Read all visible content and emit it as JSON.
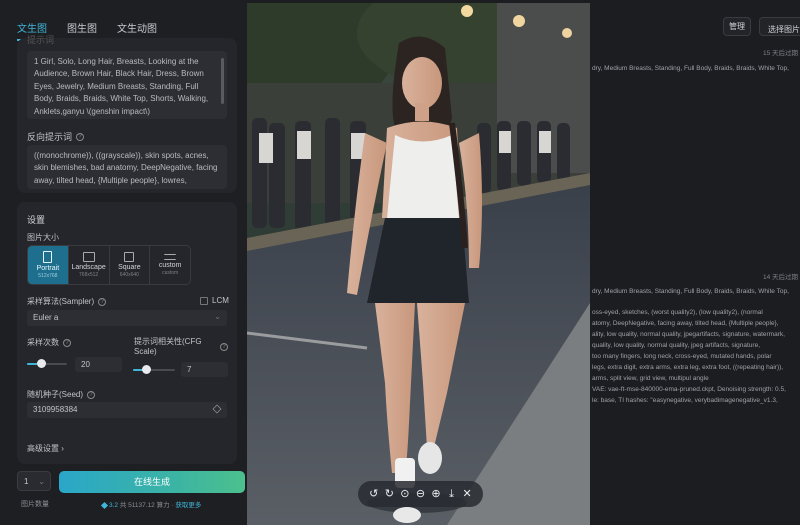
{
  "tabs": [
    {
      "label": "文生图",
      "active": true
    },
    {
      "label": "图生图",
      "active": false
    },
    {
      "label": "文生动图",
      "active": false
    }
  ],
  "prompt": {
    "label": "提示词",
    "positive_text": "1 Girl, Solo, Long Hair, Breasts, Looking at the Audience, Brown Hair, Black Hair, Dress, Brown Eyes, Jewelry, Medium Breasts, Standing, Full Body, Braids, Braids, White Top, Shorts, Walking, Anklets,ganyu \\(genshin impact\\)",
    "negative_label": "反向提示词",
    "negative_text": "((monochrome)), ((grayscale)), skin spots, acnes, skin blemishes, bad anatomy, DeepNegative, facing away, tilted head, {Multiple people}, lowres,"
  },
  "settings": {
    "title": "设置",
    "image_size_label": "图片大小",
    "sizes": [
      {
        "name": "Portrait",
        "dim": "512x768",
        "active": true
      },
      {
        "name": "Landscape",
        "dim": "768x512",
        "active": false
      },
      {
        "name": "Square",
        "dim": "640x640",
        "active": false
      },
      {
        "name": "custom",
        "dim": "custom",
        "active": false
      }
    ],
    "sampler_label": "采样算法(Sampler)",
    "lcm_label": "LCM",
    "sampler_value": "Euler a",
    "steps_label": "采样次数",
    "steps_value": "20",
    "steps_fraction": 0.35,
    "cfg_label": "提示词相关性(CFG Scale)",
    "cfg_value": "7",
    "cfg_fraction": 0.3,
    "seed_label": "随机种子(Seed)",
    "seed_value": "3109958384",
    "advanced_label": "高级设置 ›"
  },
  "generate": {
    "count_value": "1",
    "button_label": "在线生成",
    "count_label": "图片数量",
    "balance_amount": "3.2",
    "balance_rest": "共 51137.12 算力 ·",
    "balance_link": "获取更多"
  },
  "history": {
    "manage_label": "管理",
    "select_label": "选择图片",
    "expire_1": "15 天后过期",
    "meta_1": "dry, Medium Breasts, Standing, Full Body, Braids, Braids, White Top,",
    "expire_2": "14 天后过期",
    "meta_2": "dry, Medium Breasts, Standing, Full Body, Braids, Braids, White Top,",
    "detail_lines": [
      "oss-eyed, sketches, (worst quality2), (low quality2), (normal",
      "atomy, DeepNegative, facing away, tilted head, {Multiple people},",
      "ality, low quality, normal quality, jpegartifacts, signature, watermark,",
      "quality, low quality, normal quality, jpeg artifacts, signature,",
      "too many fingers, long neck, cross-eyed, mutated hands, polar",
      "legs, extra digit, extra arms, extra leg, extra foot, ((repeating hair)),",
      "arms, split view, grid view, multipul angle",
      "VAE: vae-ft-mse-840000-ema-pruned.ckpt, Denoising strength: 0.5,",
      "le: base, TI hashes: \"easynegative, verybadimagenegative_v1.3,"
    ]
  },
  "viewer_tools": [
    "rotate-left-icon",
    "rotate-right-icon",
    "reset-icon",
    "zoom-out-icon",
    "zoom-in-icon",
    "download-icon",
    "close-icon"
  ]
}
